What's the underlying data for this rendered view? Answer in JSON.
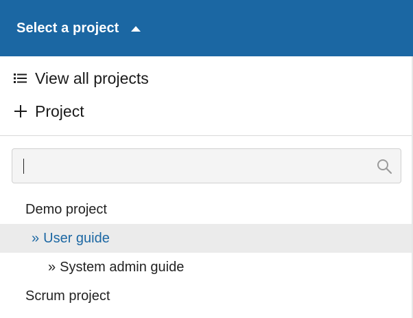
{
  "header": {
    "title": "Select a project",
    "caret_icon": "caret-up-icon",
    "background_color": "#1b67a3"
  },
  "actions": {
    "view_all": {
      "label": "View all projects",
      "icon": "list-icon"
    },
    "new_project": {
      "label": "Project",
      "icon": "plus-icon"
    }
  },
  "search": {
    "value": "",
    "placeholder": "",
    "icon": "search-icon"
  },
  "projects": [
    {
      "prefix": "",
      "name": "Demo project",
      "level": 0,
      "active": false
    },
    {
      "prefix": "»",
      "name": "User guide",
      "level": 1,
      "active": true
    },
    {
      "prefix": "»",
      "name": "System admin guide",
      "level": 2,
      "active": false
    },
    {
      "prefix": "",
      "name": "Scrum project",
      "level": 0,
      "active": false
    }
  ],
  "colors": {
    "accent": "#1b67a3",
    "active_row_bg": "#ebebeb"
  }
}
